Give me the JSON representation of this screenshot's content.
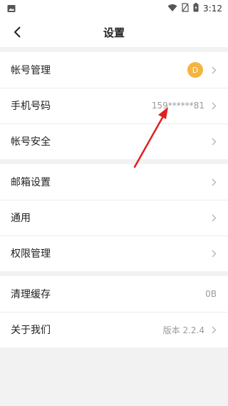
{
  "status_bar": {
    "time": "3:12"
  },
  "header": {
    "title": "设置"
  },
  "groups": [
    {
      "items": [
        {
          "label": "帐号管理",
          "avatar_letter": "D"
        },
        {
          "label": "手机号码",
          "value": "159******81"
        },
        {
          "label": "帐号安全"
        }
      ]
    },
    {
      "items": [
        {
          "label": "邮箱设置"
        },
        {
          "label": "通用"
        },
        {
          "label": "权限管理"
        }
      ]
    },
    {
      "items": [
        {
          "label": "清理缓存",
          "value": "0B"
        },
        {
          "label": "关于我们",
          "value": "版本 2.2.4"
        }
      ]
    }
  ],
  "colors": {
    "avatar_bg": "#f4b53f",
    "annotation_arrow": "#e02020"
  }
}
